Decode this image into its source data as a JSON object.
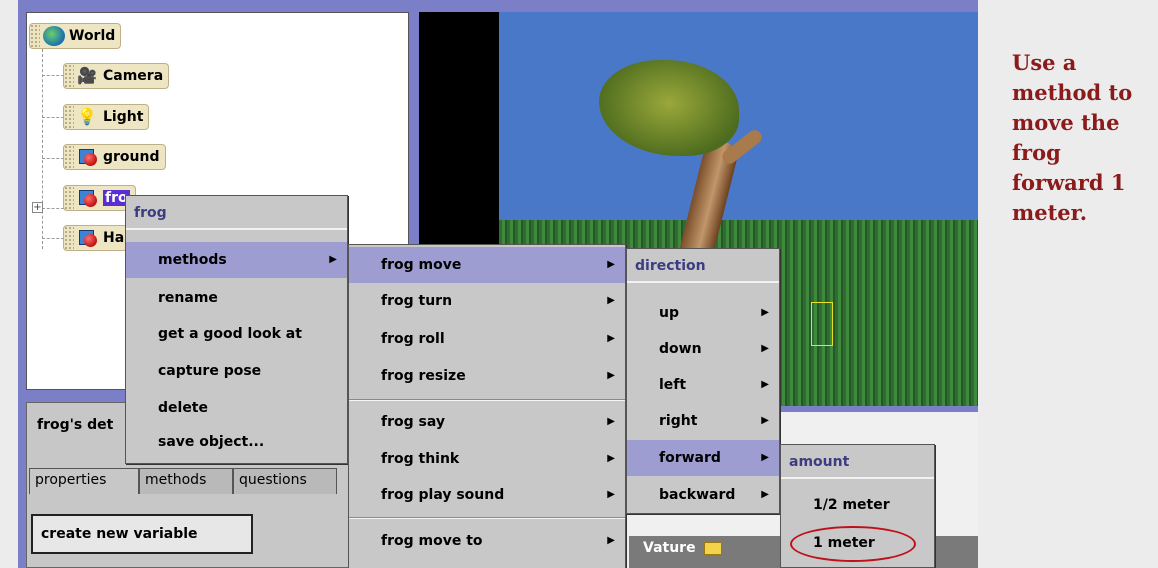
{
  "object_tree": {
    "items": [
      {
        "label": "World",
        "icon": "world-icon"
      },
      {
        "label": "Camera",
        "icon": "camera-icon"
      },
      {
        "label": "Light",
        "icon": "light-bulb-icon"
      },
      {
        "label": "ground",
        "icon": "object-icon"
      },
      {
        "label": "fro",
        "icon": "object-icon",
        "selected": true
      },
      {
        "label": "Ha",
        "icon": "object-icon"
      }
    ],
    "expander": "+"
  },
  "details_panel": {
    "title": "frog's det",
    "tabs": [
      {
        "label": "properties",
        "active": true
      },
      {
        "label": "methods",
        "active": false
      },
      {
        "label": "questions",
        "active": false
      }
    ],
    "create_variable_label": "create new variable"
  },
  "gallery": {
    "folder_label": "Vature"
  },
  "menus": {
    "object_menu": {
      "title": "frog",
      "items": [
        "methods",
        "rename",
        "get a good look at",
        "capture pose",
        "delete",
        "save object..."
      ]
    },
    "methods_menu": {
      "items": [
        "frog move",
        "frog turn",
        "frog roll",
        "frog resize",
        "frog say",
        "frog think",
        "frog play sound",
        "frog move to"
      ]
    },
    "direction_menu": {
      "title": "direction",
      "items": [
        "up",
        "down",
        "left",
        "right",
        "forward",
        "backward"
      ]
    },
    "amount_menu": {
      "title": "amount",
      "items": [
        "1/2 meter",
        "1 meter"
      ]
    }
  },
  "instruction": "Use a\nmethod to\nmove the\nfrog\nforward 1\nmeter.",
  "colors": {
    "instruction_text": "#8b1a1a",
    "highlight": "#9d9dd2",
    "menu_title": "#3c3c82",
    "annotation_ring": "#c0101a"
  }
}
